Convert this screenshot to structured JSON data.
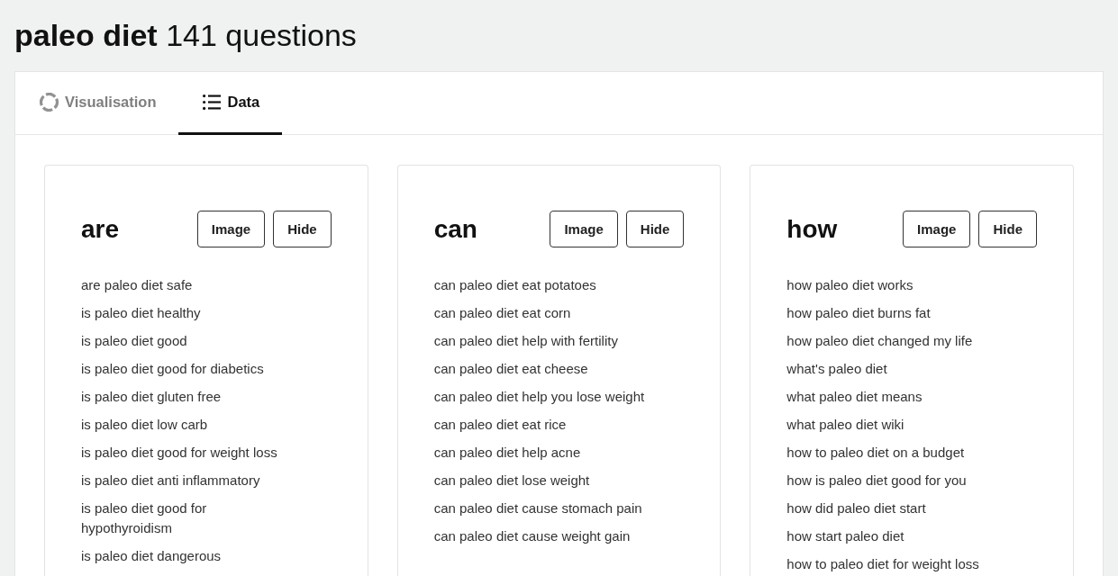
{
  "page_title": "**paleo diet** 141 questions",
  "tabs": [
    {
      "label": "Visualisation",
      "selected": false
    },
    {
      "label": "Data",
      "selected": true
    }
  ],
  "groups": [
    {
      "heading": "are",
      "buttons": [
        "Image",
        "Hide"
      ],
      "questions": [
        "are paleo diet safe",
        "is paleo diet healthy",
        "is paleo diet good",
        "is paleo diet good for diabetics",
        "is paleo diet gluten free",
        "is paleo diet low carb",
        "is paleo diet good for weight loss",
        "is paleo diet anti inflammatory",
        "is paleo diet good for hypothyroidism",
        "is paleo diet dangerous"
      ]
    },
    {
      "heading": "can",
      "buttons": [
        "Image",
        "Hide"
      ],
      "questions": [
        "can paleo diet eat potatoes",
        "can paleo diet eat corn",
        "can paleo diet help with fertility",
        "can paleo diet eat cheese",
        "can paleo diet help you lose weight",
        "can paleo diet eat rice",
        "can paleo diet help acne",
        "can paleo diet lose weight",
        "can paleo diet cause stomach pain",
        "can paleo diet cause weight gain"
      ]
    },
    {
      "heading": "how",
      "buttons": [
        "Image",
        "Hide"
      ],
      "questions": [
        "how paleo diet works",
        "how paleo diet burns fat",
        "how paleo diet changed my life",
        "what's paleo diet",
        "what paleo diet means",
        "what paleo diet wiki",
        "how to paleo diet on a budget",
        "how is paleo diet good for you",
        "how did paleo diet start",
        "how start paleo diet",
        "how to paleo diet for weight loss"
      ]
    }
  ]
}
